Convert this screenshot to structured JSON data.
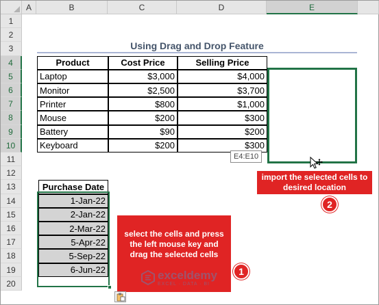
{
  "sheet": {
    "columns": [
      "A",
      "B",
      "C",
      "D",
      "E"
    ],
    "rows": [
      "1",
      "2",
      "3",
      "4",
      "5",
      "6",
      "7",
      "8",
      "9",
      "10",
      "11",
      "12",
      "13",
      "14",
      "15",
      "16",
      "17",
      "18",
      "19",
      "20"
    ],
    "title": "Using Drag and Drop Feature"
  },
  "table": {
    "headers": [
      "Product",
      "Cost Price",
      "Selling Price"
    ],
    "rows": [
      [
        "Laptop",
        "$3,000",
        "$4,000"
      ],
      [
        "Monitor",
        "$2,500",
        "$3,700"
      ],
      [
        "Printer",
        "$800",
        "$1,000"
      ],
      [
        "Mouse",
        "$200",
        "$300"
      ],
      [
        "Battery",
        "$90",
        "$200"
      ],
      [
        "Keyboard",
        "$200",
        "$300"
      ]
    ]
  },
  "dates": {
    "header": "Purchase Date",
    "values": [
      "1-Jan-22",
      "2-Jan-22",
      "2-Mar-22",
      "5-Apr-22",
      "5-Sep-22",
      "6-Jun-22"
    ]
  },
  "tooltip": "E4:E10",
  "callouts": {
    "one": {
      "text": "select the cells and press the left mouse key and drag the selected cells",
      "badge": "1"
    },
    "two": {
      "text": "import the selected cells to desired location",
      "badge": "2"
    }
  },
  "watermark": {
    "brand": "exceldemy",
    "tagline": "EXCEL · DATA · BI"
  },
  "colors": {
    "excel_green": "#217346",
    "callout_red": "#e02424",
    "title": "#44546a"
  },
  "icons": [
    "move-cursor-icon",
    "paste-options-icon",
    "exceldemy-logo-icon"
  ]
}
